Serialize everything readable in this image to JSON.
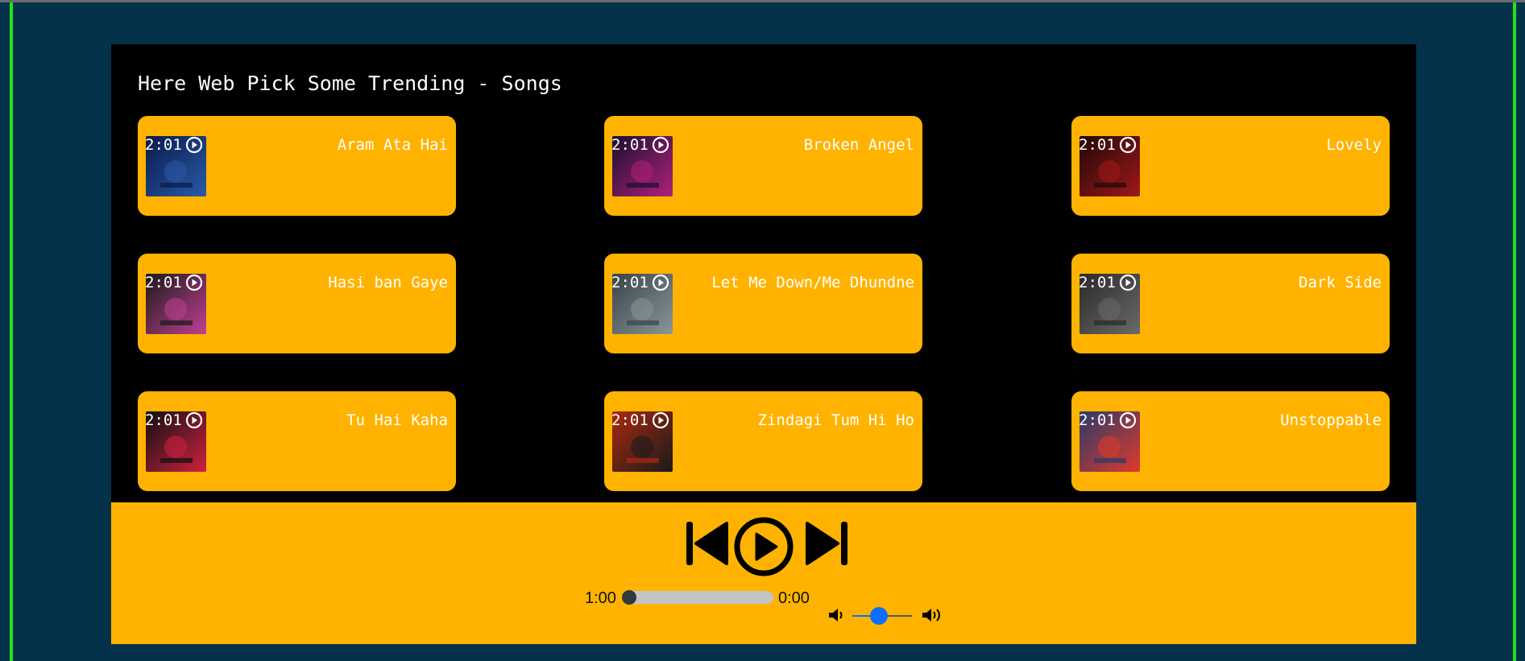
{
  "heading": "Here Web Pick Some Trending - Songs",
  "songs": [
    {
      "title": "Aram Ata Hai",
      "time": "2:01",
      "art_colors": [
        "#0a1a4a",
        "#2a5aa8"
      ]
    },
    {
      "title": "Broken Angel",
      "time": "2:01",
      "art_colors": [
        "#1a1030",
        "#b0207a"
      ]
    },
    {
      "title": "Lovely",
      "time": "2:01",
      "art_colors": [
        "#200808",
        "#a01818"
      ]
    },
    {
      "title": "Hasi ban Gaye",
      "time": "2:01",
      "art_colors": [
        "#1a1a1a",
        "#c04090"
      ]
    },
    {
      "title": "Let Me Down/Me Dhundne",
      "time": "2:01",
      "art_colors": [
        "#3a4448",
        "#8a969a"
      ]
    },
    {
      "title": "Dark Side",
      "time": "2:01",
      "art_colors": [
        "#2a2a2a",
        "#6a6a6a"
      ]
    },
    {
      "title": "Tu Hai Kaha",
      "time": "2:01",
      "art_colors": [
        "#101010",
        "#d02040"
      ]
    },
    {
      "title": "Zindagi Tum Hi Ho",
      "time": "2:01",
      "art_colors": [
        "#a82a10",
        "#1a1a1a"
      ]
    },
    {
      "title": "Unstoppable",
      "time": "2:01",
      "art_colors": [
        "#2a3a6a",
        "#e03a2a"
      ]
    }
  ],
  "player": {
    "current_time": "1:00",
    "duration": "0:00",
    "progress_fraction": 0.0,
    "volume_fraction": 0.45,
    "icons": {
      "previous": "skip-previous-icon",
      "play": "play-circle-icon",
      "next": "skip-next-icon",
      "volume_down": "volume-down-icon",
      "volume_up": "volume-up-icon"
    }
  },
  "colors": {
    "page_bg": "#04324a",
    "panel_bg": "#000000",
    "card_bg": "#ffb300",
    "accent_blue": "#0d6efd",
    "border_green": "#1ee51e"
  }
}
